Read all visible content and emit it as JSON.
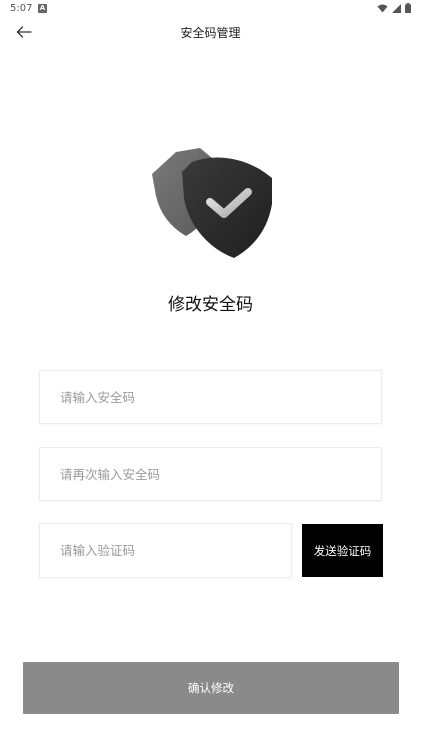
{
  "status_bar": {
    "time": "5:07",
    "notification_icon": "a-notification-icon",
    "system_icons": [
      "wifi-icon",
      "signal-icon",
      "battery-icon"
    ]
  },
  "header": {
    "back_icon": "arrow-left-icon",
    "title": "安全码管理"
  },
  "illustration": {
    "icon": "shield-check-icon",
    "colors": {
      "front_shield": "#2b2b2b",
      "back_shield": "#6e6e6e",
      "check": "#d9d9d9"
    }
  },
  "heading": "修改安全码",
  "form": {
    "security_code": {
      "placeholder": "请输入安全码",
      "value": ""
    },
    "security_code_confirm": {
      "placeholder": "请再次输入安全码",
      "value": ""
    },
    "verification_code": {
      "placeholder": "请输入验证码",
      "value": ""
    },
    "send_code_label": "发送验证码",
    "confirm_label": "确认修改"
  },
  "colors": {
    "send_button_bg": "#000000",
    "confirm_button_bg": "#8a8a8a",
    "placeholder": "#9a9a9a"
  }
}
